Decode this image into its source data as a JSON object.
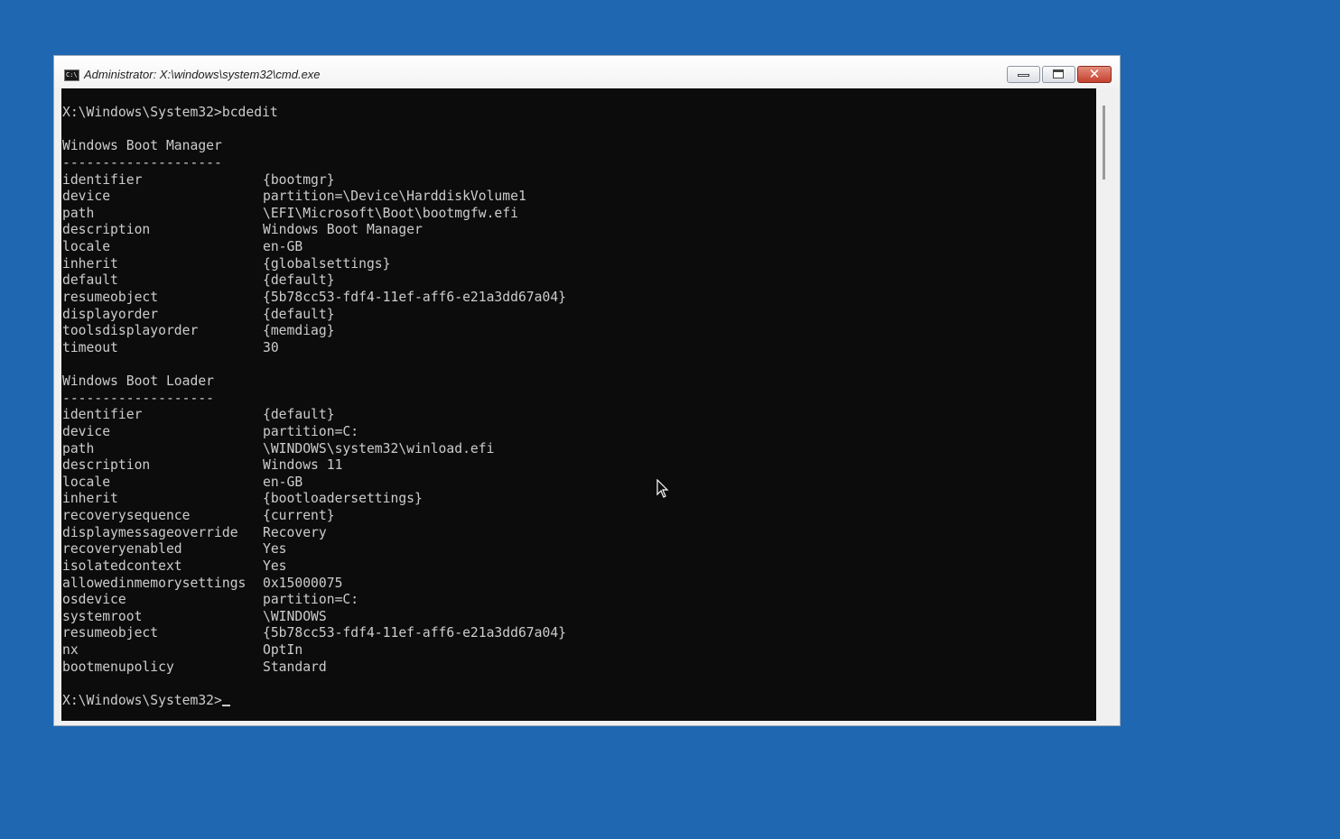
{
  "window": {
    "title": "Administrator: X:\\windows\\system32\\cmd.exe",
    "icon": "cmd-icon",
    "icon_text": "C:\\"
  },
  "console": {
    "command_line": "X:\\Windows\\System32>bcdedit",
    "sections": [
      {
        "heading": "Windows Boot Manager",
        "rule": "--------------------",
        "rows": [
          {
            "key": "identifier",
            "value": "{bootmgr}"
          },
          {
            "key": "device",
            "value": "partition=\\Device\\HarddiskVolume1"
          },
          {
            "key": "path",
            "value": "\\EFI\\Microsoft\\Boot\\bootmgfw.efi"
          },
          {
            "key": "description",
            "value": "Windows Boot Manager"
          },
          {
            "key": "locale",
            "value": "en-GB"
          },
          {
            "key": "inherit",
            "value": "{globalsettings}"
          },
          {
            "key": "default",
            "value": "{default}"
          },
          {
            "key": "resumeobject",
            "value": "{5b78cc53-fdf4-11ef-aff6-e21a3dd67a04}"
          },
          {
            "key": "displayorder",
            "value": "{default}"
          },
          {
            "key": "toolsdisplayorder",
            "value": "{memdiag}"
          },
          {
            "key": "timeout",
            "value": "30"
          }
        ]
      },
      {
        "heading": "Windows Boot Loader",
        "rule": "-------------------",
        "rows": [
          {
            "key": "identifier",
            "value": "{default}"
          },
          {
            "key": "device",
            "value": "partition=C:"
          },
          {
            "key": "path",
            "value": "\\WINDOWS\\system32\\winload.efi"
          },
          {
            "key": "description",
            "value": "Windows 11"
          },
          {
            "key": "locale",
            "value": "en-GB"
          },
          {
            "key": "inherit",
            "value": "{bootloadersettings}"
          },
          {
            "key": "recoverysequence",
            "value": "{current}"
          },
          {
            "key": "displaymessageoverride",
            "value": "Recovery"
          },
          {
            "key": "recoveryenabled",
            "value": "Yes"
          },
          {
            "key": "isolatedcontext",
            "value": "Yes"
          },
          {
            "key": "allowedinmemorysettings",
            "value": "0x15000075"
          },
          {
            "key": "osdevice",
            "value": "partition=C:"
          },
          {
            "key": "systemroot",
            "value": "\\WINDOWS"
          },
          {
            "key": "resumeobject",
            "value": "{5b78cc53-fdf4-11ef-aff6-e21a3dd67a04}"
          },
          {
            "key": "nx",
            "value": "OptIn"
          },
          {
            "key": "bootmenupolicy",
            "value": "Standard"
          }
        ]
      }
    ],
    "prompt": "X:\\Windows\\System32>"
  },
  "colors": {
    "desktop": "#1f67b1",
    "console_bg": "#0c0c0c",
    "console_fg": "#cccccc"
  }
}
